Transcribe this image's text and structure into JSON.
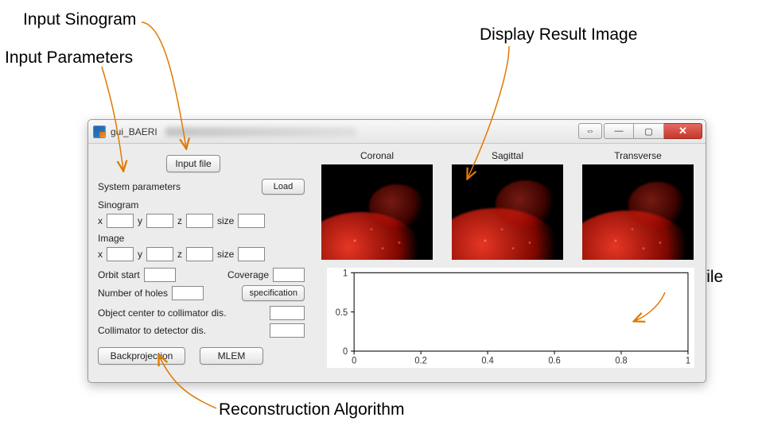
{
  "annotations": {
    "input_sinogram": "Input Sinogram",
    "input_parameters": "Input Parameters",
    "display_result_image": "Display Result Image",
    "display_profile": "Display Profile",
    "reconstruction_algorithm": "Reconstruction Algorithm"
  },
  "window": {
    "title": "gui_BAERI",
    "buttons": {
      "aux": "⇔",
      "minimize": "—",
      "maximize": "▢",
      "close": "✕"
    }
  },
  "controls": {
    "input_file_btn": "Input file",
    "system_parameters_label": "System parameters",
    "load_btn": "Load",
    "sinogram_heading": "Sinogram",
    "sinogram": {
      "x_label": "x",
      "y_label": "y",
      "z_label": "z",
      "size_label": "size"
    },
    "image_heading": "Image",
    "image": {
      "x_label": "x",
      "y_label": "y",
      "z_label": "z",
      "size_label": "size"
    },
    "orbit_start_label": "Orbit start",
    "orbit_start_value": "",
    "coverage_label": "Coverage",
    "coverage_value": "",
    "num_holes_label": "Number of holes",
    "num_holes_value": "",
    "specification_btn": "specification",
    "obj_center_label": "Object center to collimator dis.",
    "obj_center_value": "",
    "coll_det_label": "Collimator to detector dis.",
    "coll_det_value": "",
    "backprojection_btn": "Backprojection",
    "mlem_btn": "MLEM"
  },
  "views": {
    "coronal": "Coronal",
    "sagittal": "Sagittal",
    "transverse": "Transverse"
  },
  "chart_data": {
    "type": "line",
    "title": "",
    "xlabel": "",
    "ylabel": "",
    "xlim": [
      0,
      1
    ],
    "ylim": [
      0,
      1
    ],
    "xticks": [
      0,
      0.2,
      0.4,
      0.6,
      0.8,
      1
    ],
    "yticks": [
      0,
      0.5,
      1
    ],
    "x": [],
    "values": []
  }
}
